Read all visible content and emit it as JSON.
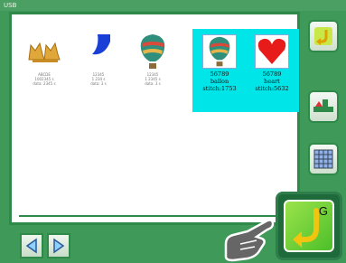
{
  "window": {
    "title": "USB"
  },
  "designs": [
    {
      "icon": "twin-cat-design-icon",
      "lines": [
        "ABCDE",
        "1002345 s",
        "data: 2345 s"
      ]
    },
    {
      "icon": "blue-shape-design-icon",
      "lines": [
        "12345",
        "1 234 s",
        "data: 3 s"
      ]
    },
    {
      "icon": "balloon-design-icon",
      "lines": [
        "12345",
        "1 2345 s",
        "data: 3 s"
      ]
    }
  ],
  "selected_designs": [
    {
      "icon": "balloon-design-icon",
      "number": "56789",
      "name": "ballon",
      "stitch": "stitch:1753"
    },
    {
      "icon": "heart-design-icon",
      "number": "56789",
      "name": "heart",
      "stitch": "stitch:5632"
    }
  ],
  "buttons": {
    "go_letter": "G"
  },
  "colors": {
    "background": "#3f9a5a",
    "selection": "#00e5e8",
    "go_button": "#6fd13a"
  }
}
